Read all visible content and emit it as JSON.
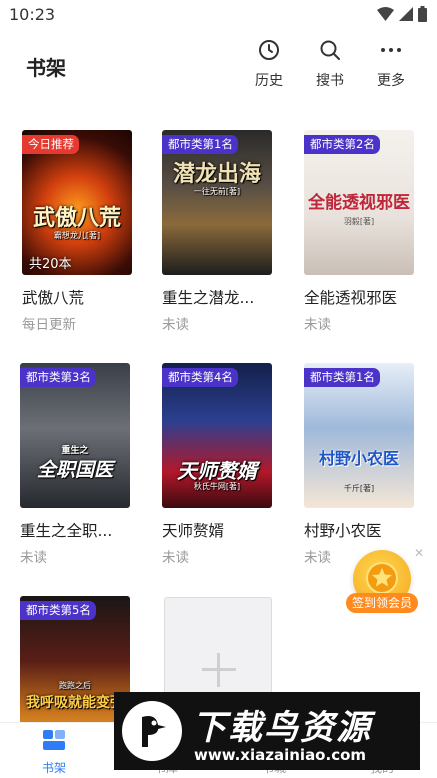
{
  "status_bar": {
    "time": "10:23"
  },
  "header": {
    "title": "书架",
    "actions": [
      {
        "label": "历史",
        "icon": "clock-icon"
      },
      {
        "label": "搜书",
        "icon": "search-icon"
      },
      {
        "label": "更多",
        "icon": "more-dots-icon"
      }
    ]
  },
  "books": [
    {
      "badge": "今日推荐",
      "badge_color": "#e6392f",
      "cover_title": "武傲八荒",
      "cover_author": "霸想龙儿[著]",
      "chapter_count": "共20本",
      "title": "武傲八荒",
      "status": "每日更新"
    },
    {
      "badge": "都市类第1名",
      "badge_color": "#4b33c9",
      "cover_title": "潜龙出海",
      "cover_author": "一往无前[著]",
      "title": "重生之潜龙...",
      "status": "未读"
    },
    {
      "badge": "都市类第2名",
      "badge_color": "#4b33c9",
      "cover_title": "全能透视邪医",
      "cover_author": "羽毅[著]",
      "title": "全能透视邪医",
      "status": "未读"
    },
    {
      "badge": "都市类第3名",
      "badge_color": "#4b33c9",
      "cover_title": "全职国医",
      "cover_author": "重生之",
      "title": "重生之全职...",
      "status": "未读"
    },
    {
      "badge": "都市类第4名",
      "badge_color": "#4b33c9",
      "cover_title": "天师赘婿",
      "cover_author": "秋氏牛网[著]",
      "title": "天师赘婿",
      "status": "未读"
    },
    {
      "badge": "都市类第1名",
      "badge_color": "#4b33c9",
      "cover_title": "村野小农医",
      "cover_author": "千斤[著]",
      "title": "村野小农医",
      "status": "未读"
    },
    {
      "badge": "都市类第5名",
      "badge_color": "#4b33c9",
      "cover_title": "我呼吸就能变强",
      "cover_author": "跑跑之后",
      "title": "",
      "status": ""
    }
  ],
  "promo": {
    "label": "签到领会员"
  },
  "bottom_nav": [
    {
      "label": "书架",
      "icon": "bookshelf-icon",
      "active": true
    },
    {
      "label": "书库",
      "icon": "library-icon",
      "active": false
    },
    {
      "label": "书城",
      "icon": "store-icon",
      "active": false
    },
    {
      "label": "我的",
      "icon": "profile-icon",
      "active": false
    }
  ],
  "watermark": {
    "title": "下载鸟资源",
    "url": "www.xiazainiao.com"
  },
  "colors": {
    "accent": "#2f7df6",
    "badge_red": "#e6392f",
    "badge_purple": "#4b33c9",
    "promo_orange": "#ff8a1e"
  }
}
